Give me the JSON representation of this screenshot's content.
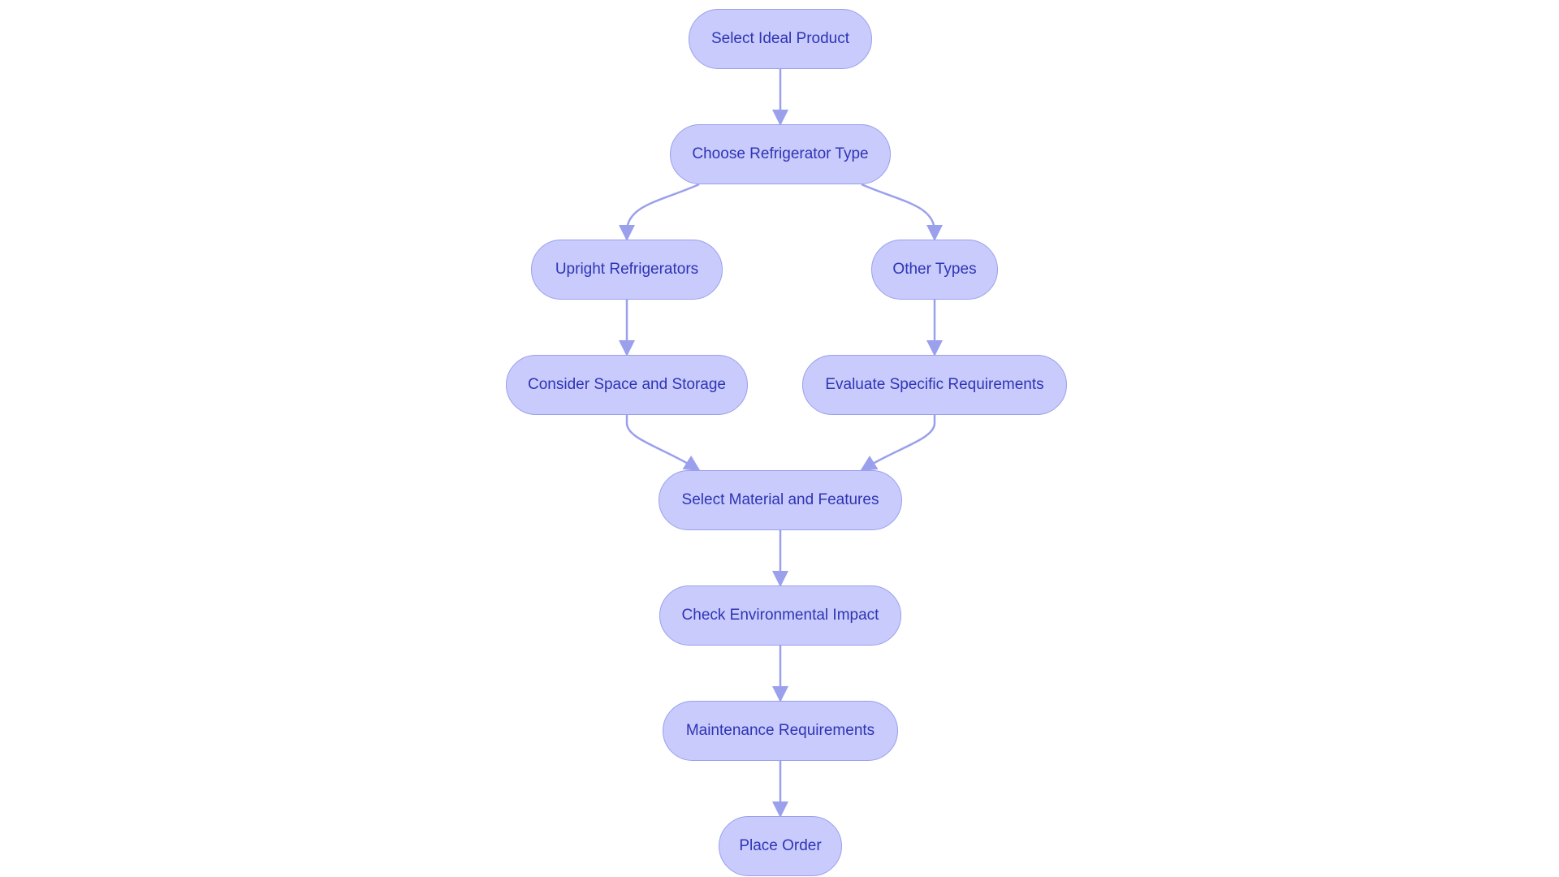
{
  "diagram": {
    "type": "flowchart",
    "colors": {
      "node_fill": "#c8cbfc",
      "node_border": "#9aa0ec",
      "text": "#2f34b4",
      "edge": "#9aa0ec"
    },
    "nodes": [
      {
        "id": "n1",
        "label": "Select Ideal Product"
      },
      {
        "id": "n2",
        "label": "Choose Refrigerator Type"
      },
      {
        "id": "n3",
        "label": "Upright Refrigerators"
      },
      {
        "id": "n4",
        "label": "Other Types"
      },
      {
        "id": "n5",
        "label": "Consider Space and Storage"
      },
      {
        "id": "n6",
        "label": "Evaluate Specific Requirements"
      },
      {
        "id": "n7",
        "label": "Select Material and Features"
      },
      {
        "id": "n8",
        "label": "Check Environmental Impact"
      },
      {
        "id": "n9",
        "label": "Maintenance Requirements"
      },
      {
        "id": "n10",
        "label": "Place Order"
      }
    ],
    "edges": [
      {
        "from": "n1",
        "to": "n2"
      },
      {
        "from": "n2",
        "to": "n3"
      },
      {
        "from": "n2",
        "to": "n4"
      },
      {
        "from": "n3",
        "to": "n5"
      },
      {
        "from": "n4",
        "to": "n6"
      },
      {
        "from": "n5",
        "to": "n7"
      },
      {
        "from": "n6",
        "to": "n7"
      },
      {
        "from": "n7",
        "to": "n8"
      },
      {
        "from": "n8",
        "to": "n9"
      },
      {
        "from": "n9",
        "to": "n10"
      }
    ]
  }
}
